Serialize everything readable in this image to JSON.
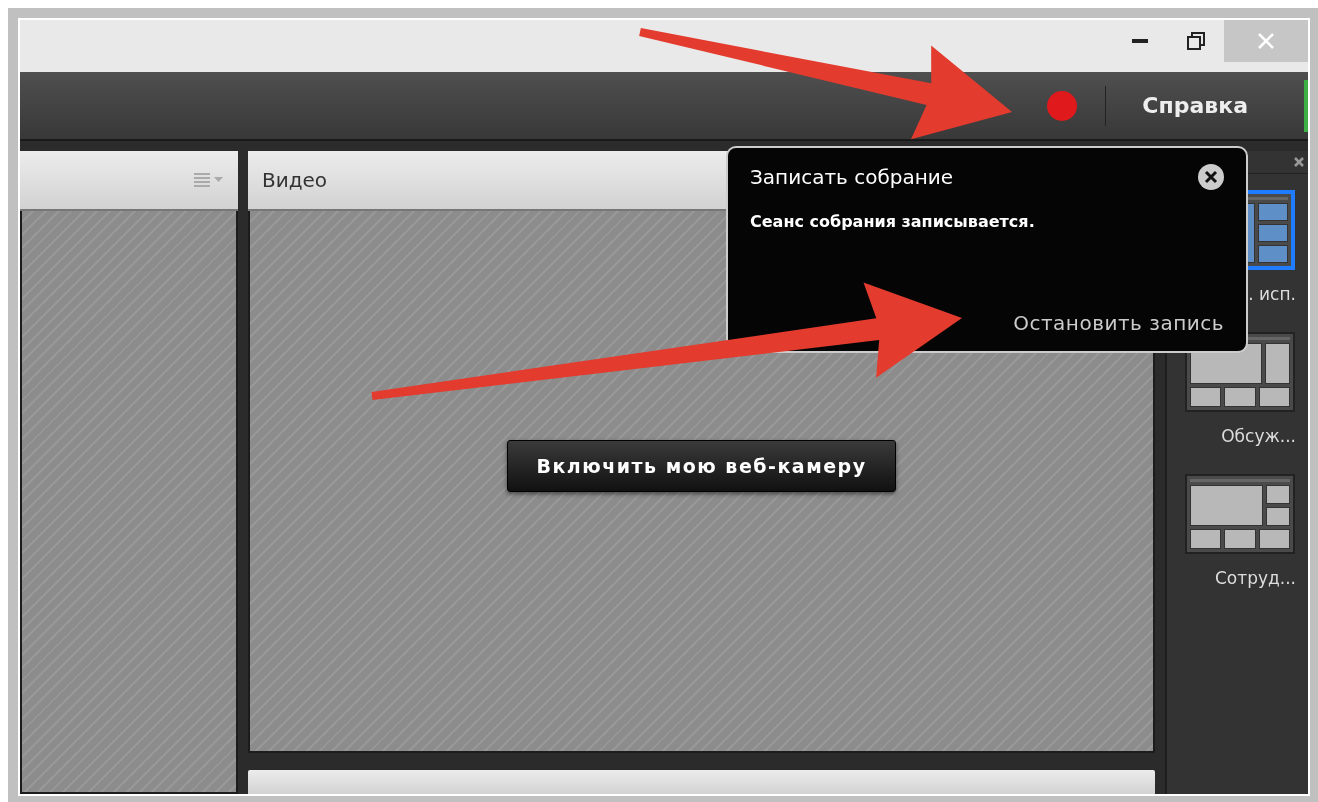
{
  "toolbar": {
    "recording": true,
    "help": "Справка"
  },
  "video_panel": {
    "title": "Видео",
    "button": "Включить мою веб-камеру"
  },
  "popup": {
    "title": "Записать собрание",
    "message": "Сеанс собрания записывается.",
    "action": "Остановить запись"
  },
  "layouts": [
    {
      "label": ". исп.",
      "selected": true,
      "kind": "share"
    },
    {
      "label": "Обсуж...",
      "selected": false,
      "kind": "discussion"
    },
    {
      "label": "Сотруд...",
      "selected": false,
      "kind": "collab"
    }
  ]
}
